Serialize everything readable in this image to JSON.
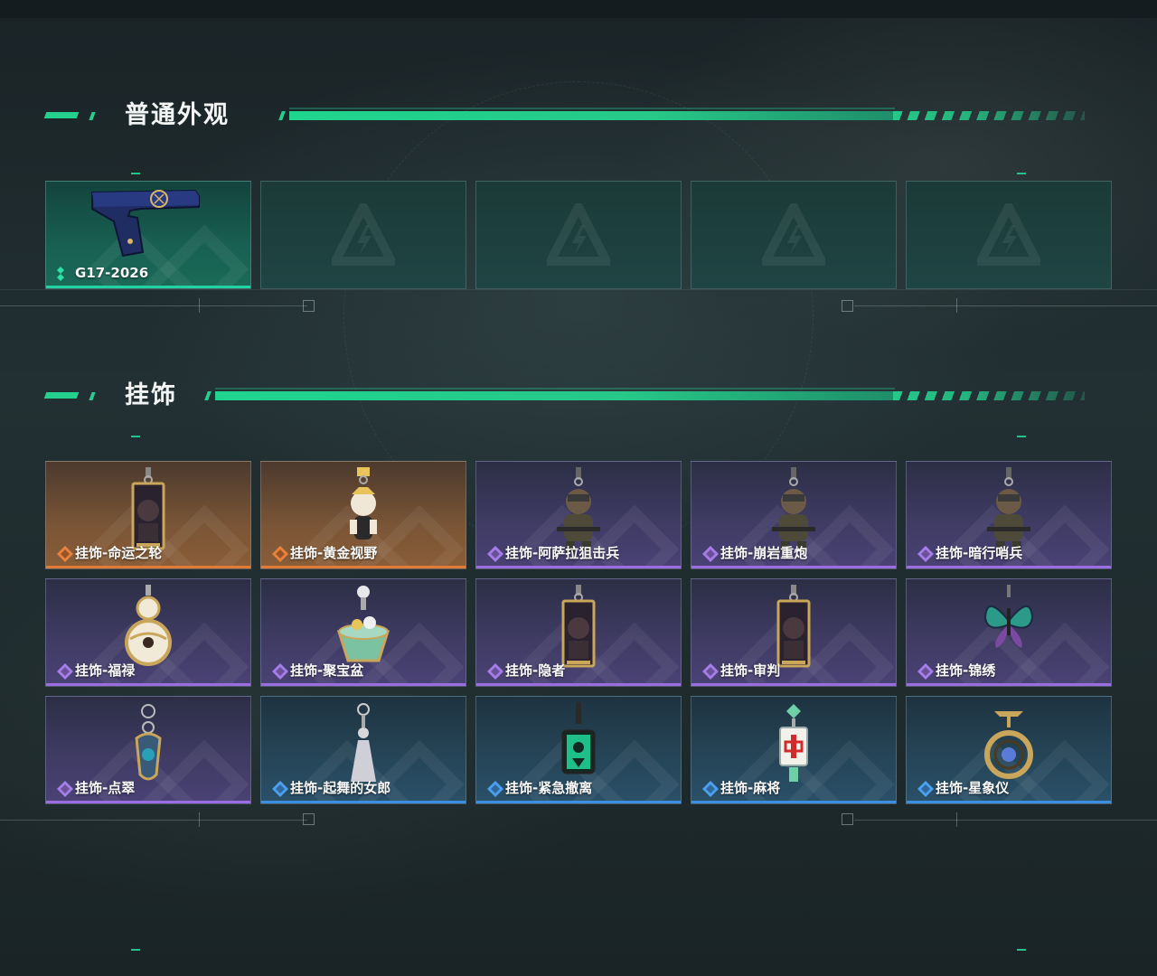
{
  "sections": [
    {
      "title": "普通外观",
      "items": [
        {
          "label": "G17-2026",
          "rarity": "green",
          "icon": "pistol-icon"
        },
        {
          "label": "",
          "rarity": "empty",
          "icon": "empty-slot-logo-icon"
        },
        {
          "label": "",
          "rarity": "empty",
          "icon": "empty-slot-logo-icon"
        },
        {
          "label": "",
          "rarity": "empty",
          "icon": "empty-slot-logo-icon"
        },
        {
          "label": "",
          "rarity": "empty",
          "icon": "empty-slot-logo-icon"
        }
      ]
    },
    {
      "title": "挂饰",
      "items": [
        {
          "label": "挂饰-命运之轮",
          "rarity": "gold",
          "icon": "tarot-card-charm-icon"
        },
        {
          "label": "挂饰-黄金视野",
          "rarity": "gold",
          "icon": "figure-charm-icon"
        },
        {
          "label": "挂饰-阿萨拉狙击兵",
          "rarity": "purple",
          "icon": "soldier-charm-icon"
        },
        {
          "label": "挂饰-崩岩重炮",
          "rarity": "purple",
          "icon": "soldier-charm-icon"
        },
        {
          "label": "挂饰-暗行哨兵",
          "rarity": "purple",
          "icon": "soldier-charm-icon"
        },
        {
          "label": "挂饰-福禄",
          "rarity": "purple",
          "icon": "gourd-charm-icon"
        },
        {
          "label": "挂饰-聚宝盆",
          "rarity": "purple",
          "icon": "treasure-bowl-charm-icon"
        },
        {
          "label": "挂饰-隐者",
          "rarity": "purple",
          "icon": "tarot-card-charm-icon"
        },
        {
          "label": "挂饰-审判",
          "rarity": "purple",
          "icon": "tarot-card-charm-icon"
        },
        {
          "label": "挂饰-锦绣",
          "rarity": "purple",
          "icon": "butterfly-charm-icon"
        },
        {
          "label": "挂饰-点翠",
          "rarity": "purple",
          "icon": "jewel-charm-icon"
        },
        {
          "label": "挂饰-起舞的女郎",
          "rarity": "blue",
          "icon": "dancer-charm-icon"
        },
        {
          "label": "挂饰-紧急撤离",
          "rarity": "blue",
          "icon": "exit-sign-charm-icon"
        },
        {
          "label": "挂饰-麻将",
          "rarity": "blue",
          "icon": "mahjong-tile-charm-icon"
        },
        {
          "label": "挂饰-星象仪",
          "rarity": "blue",
          "icon": "astrolabe-charm-icon"
        }
      ]
    }
  ],
  "colors": {
    "accent": "#25d08f",
    "gold": "#e07a35",
    "purple": "#9a6ee0",
    "blue": "#3a8fe0",
    "green": "#22d2a0"
  }
}
